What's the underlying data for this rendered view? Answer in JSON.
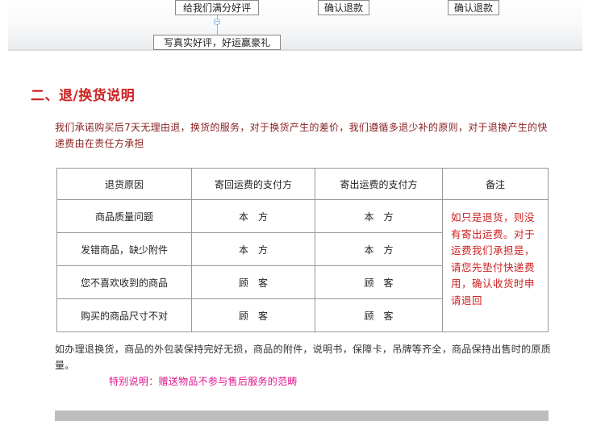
{
  "flow": {
    "step_rate": "给我们满分好评",
    "step_confirm_1": "确认退款",
    "step_confirm_2": "确认退款",
    "step_review": "写真实好评，好运赢豪礼"
  },
  "section": {
    "title": "二、退/换货说明"
  },
  "intro": {
    "text": "我们承诺购买后7天无理由退，换货的服务，对于换货产生的差价，我们遵循多退少补的原则，对于退换产生的快递费由在责任方承担"
  },
  "policy_table": {
    "headers": [
      "退货原因",
      "寄回运费的支付方",
      "寄出运费的支付方",
      "备注"
    ],
    "rows": [
      {
        "reason": "商品质量问题",
        "return_payer": "本方",
        "send_payer": "本方"
      },
      {
        "reason": "发错商品，缺少附件",
        "return_payer": "本方",
        "send_payer": "本方"
      },
      {
        "reason": "您不喜欢收到的商品",
        "return_payer": "顾客",
        "send_payer": "顾客"
      },
      {
        "reason": "购买的商品尺寸不对",
        "return_payer": "顾客",
        "send_payer": "顾客"
      }
    ],
    "note": "如只是退货，则没有寄出运费。对于运费我们承担是，请您先垫付快递费用，确认收货时申请退回"
  },
  "after": {
    "text": "如办理退换货，商品的外包装保持完好无损，商品的附件，说明书，保障卡，吊牌等齐全，商品保持出售时的原质量。"
  },
  "special_note": {
    "text": "特别说明：赠送物品不参与售后服务的范畴"
  },
  "colors": {
    "title_red": "#cc2020",
    "intro_text": "#8b2020",
    "special_pink": "#e0148c"
  }
}
